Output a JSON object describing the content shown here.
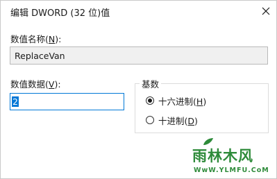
{
  "window": {
    "title": "编辑 DWORD (32 位)值",
    "close_icon": "close-icon"
  },
  "value_name": {
    "label": "数值名称",
    "hotkey_pre": "(",
    "hotkey": "N",
    "hotkey_post": "):",
    "value": "ReplaceVan"
  },
  "value_data": {
    "label": "数值数据",
    "hotkey_pre": "(",
    "hotkey": "V",
    "hotkey_post": "):",
    "value": "2"
  },
  "base": {
    "title": "基数",
    "options": [
      {
        "label": "十六进制",
        "hotkey_pre": "(",
        "hotkey": "H",
        "hotkey_post": ")",
        "selected": true
      },
      {
        "label": "十进制",
        "hotkey_pre": "(",
        "hotkey": "D",
        "hotkey_post": ")",
        "selected": false
      }
    ]
  },
  "watermark": {
    "title": "雨林木风",
    "url": "WwW.YLMFU.CoM"
  },
  "colors": {
    "accent": "#0078d7",
    "watermark": "#2e8b3a"
  }
}
